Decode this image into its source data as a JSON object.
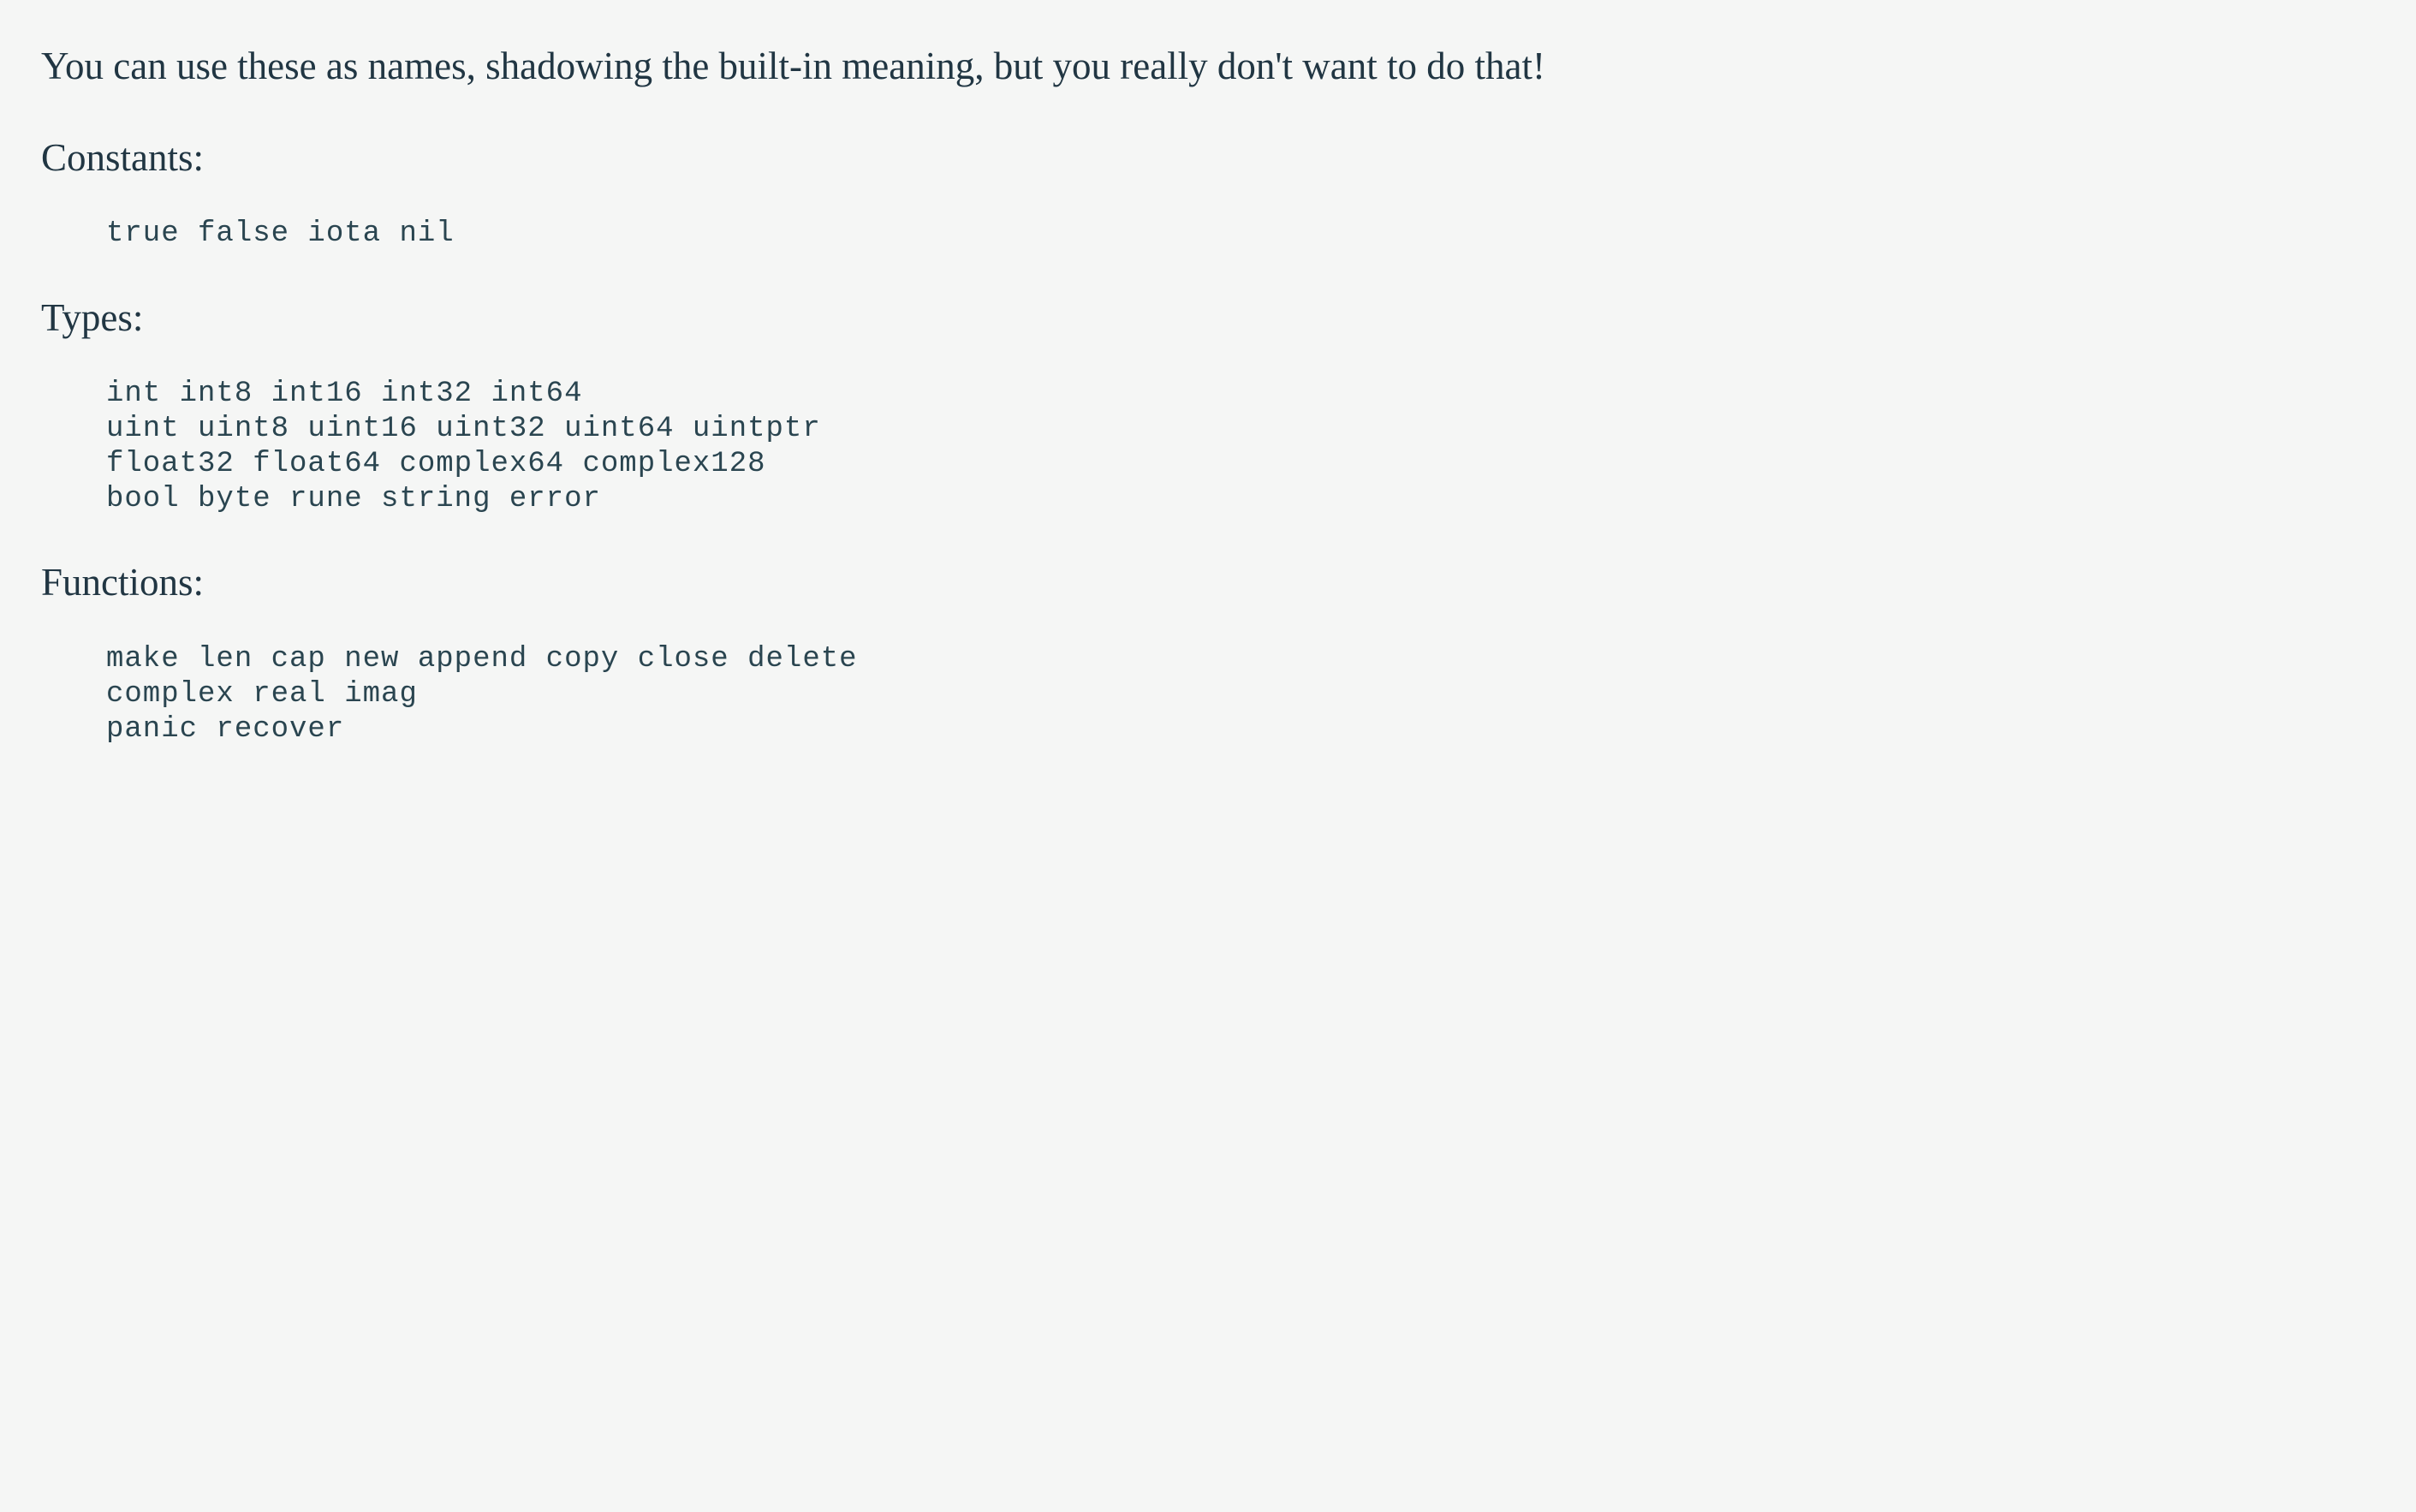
{
  "intro": "You can use these as names, shadowing the built-in meaning, but you really don't want to do that!",
  "sections": {
    "constants": {
      "heading": "Constants:",
      "code": "true false iota nil"
    },
    "types": {
      "heading": "Types:",
      "code": "int int8 int16 int32 int64\nuint uint8 uint16 uint32 uint64 uintptr\nfloat32 float64 complex64 complex128\nbool byte rune string error"
    },
    "functions": {
      "heading": "Functions:",
      "code": "make len cap new append copy close delete\ncomplex real imag\npanic recover"
    }
  }
}
